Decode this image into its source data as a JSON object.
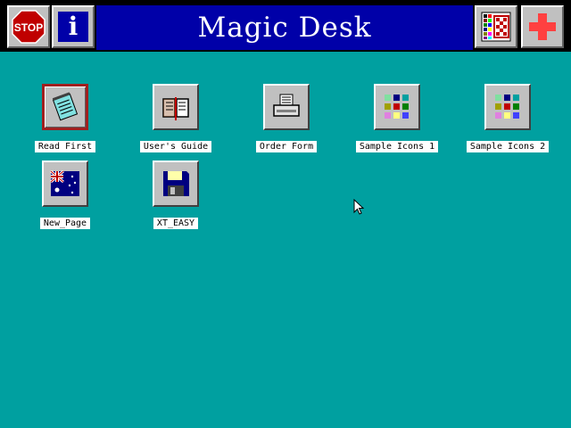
{
  "app": {
    "title": "Magic Desk"
  },
  "toolbar": {
    "stop_icon_text": "STOP",
    "info_icon_text": "i"
  },
  "desktop": {
    "icons": [
      {
        "label": "Read First",
        "icon": "notepad-icon",
        "selected": true
      },
      {
        "label": "User's Guide",
        "icon": "book-icon"
      },
      {
        "label": "Order Form",
        "icon": "printer-icon"
      },
      {
        "label": "Sample Icons 1",
        "icon": "icon-grid-icon"
      },
      {
        "label": "Sample Icons 2",
        "icon": "icon-grid-icon"
      },
      {
        "label": "New_Page",
        "icon": "australian-flag-icon"
      },
      {
        "label": "XT_EASY",
        "icon": "floppy-disk-icon"
      }
    ]
  },
  "colors": {
    "desktop_bg": "#00a0a0",
    "title_bar": "#0000a8",
    "button_face": "#c0c0c0",
    "stop_red": "#c00000",
    "plus_red": "#ff4040"
  }
}
